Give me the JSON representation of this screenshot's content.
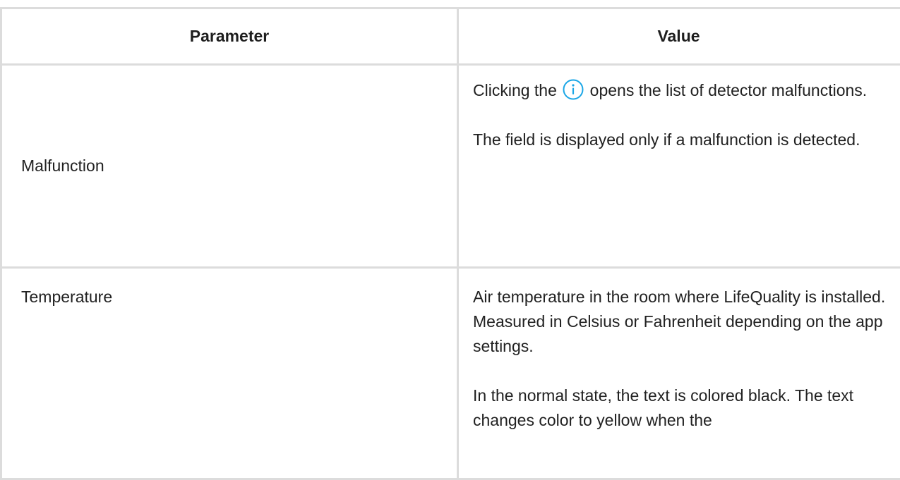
{
  "table": {
    "header": {
      "parameter": "Parameter",
      "value": "Value"
    },
    "rows": [
      {
        "parameter": "Malfunction",
        "value_p1_before_icon": "Clicking the",
        "value_p1_after_icon": "opens the list of detector malfunctions.",
        "value_p2": "The field is displayed only if a malfunction is detected."
      },
      {
        "parameter": "Temperature",
        "value_p1": "Air temperature in the room where LifeQuality is installed. Measured in Celsius or Fahrenheit depending on the app settings.",
        "value_p2": "In the normal state, the text is colored black. The text changes color to yellow when the"
      }
    ]
  },
  "icons": {
    "info": "info-icon"
  },
  "colors": {
    "text": "#212121",
    "border": "#dcdcdc",
    "info_icon": "#1aa6e6"
  }
}
